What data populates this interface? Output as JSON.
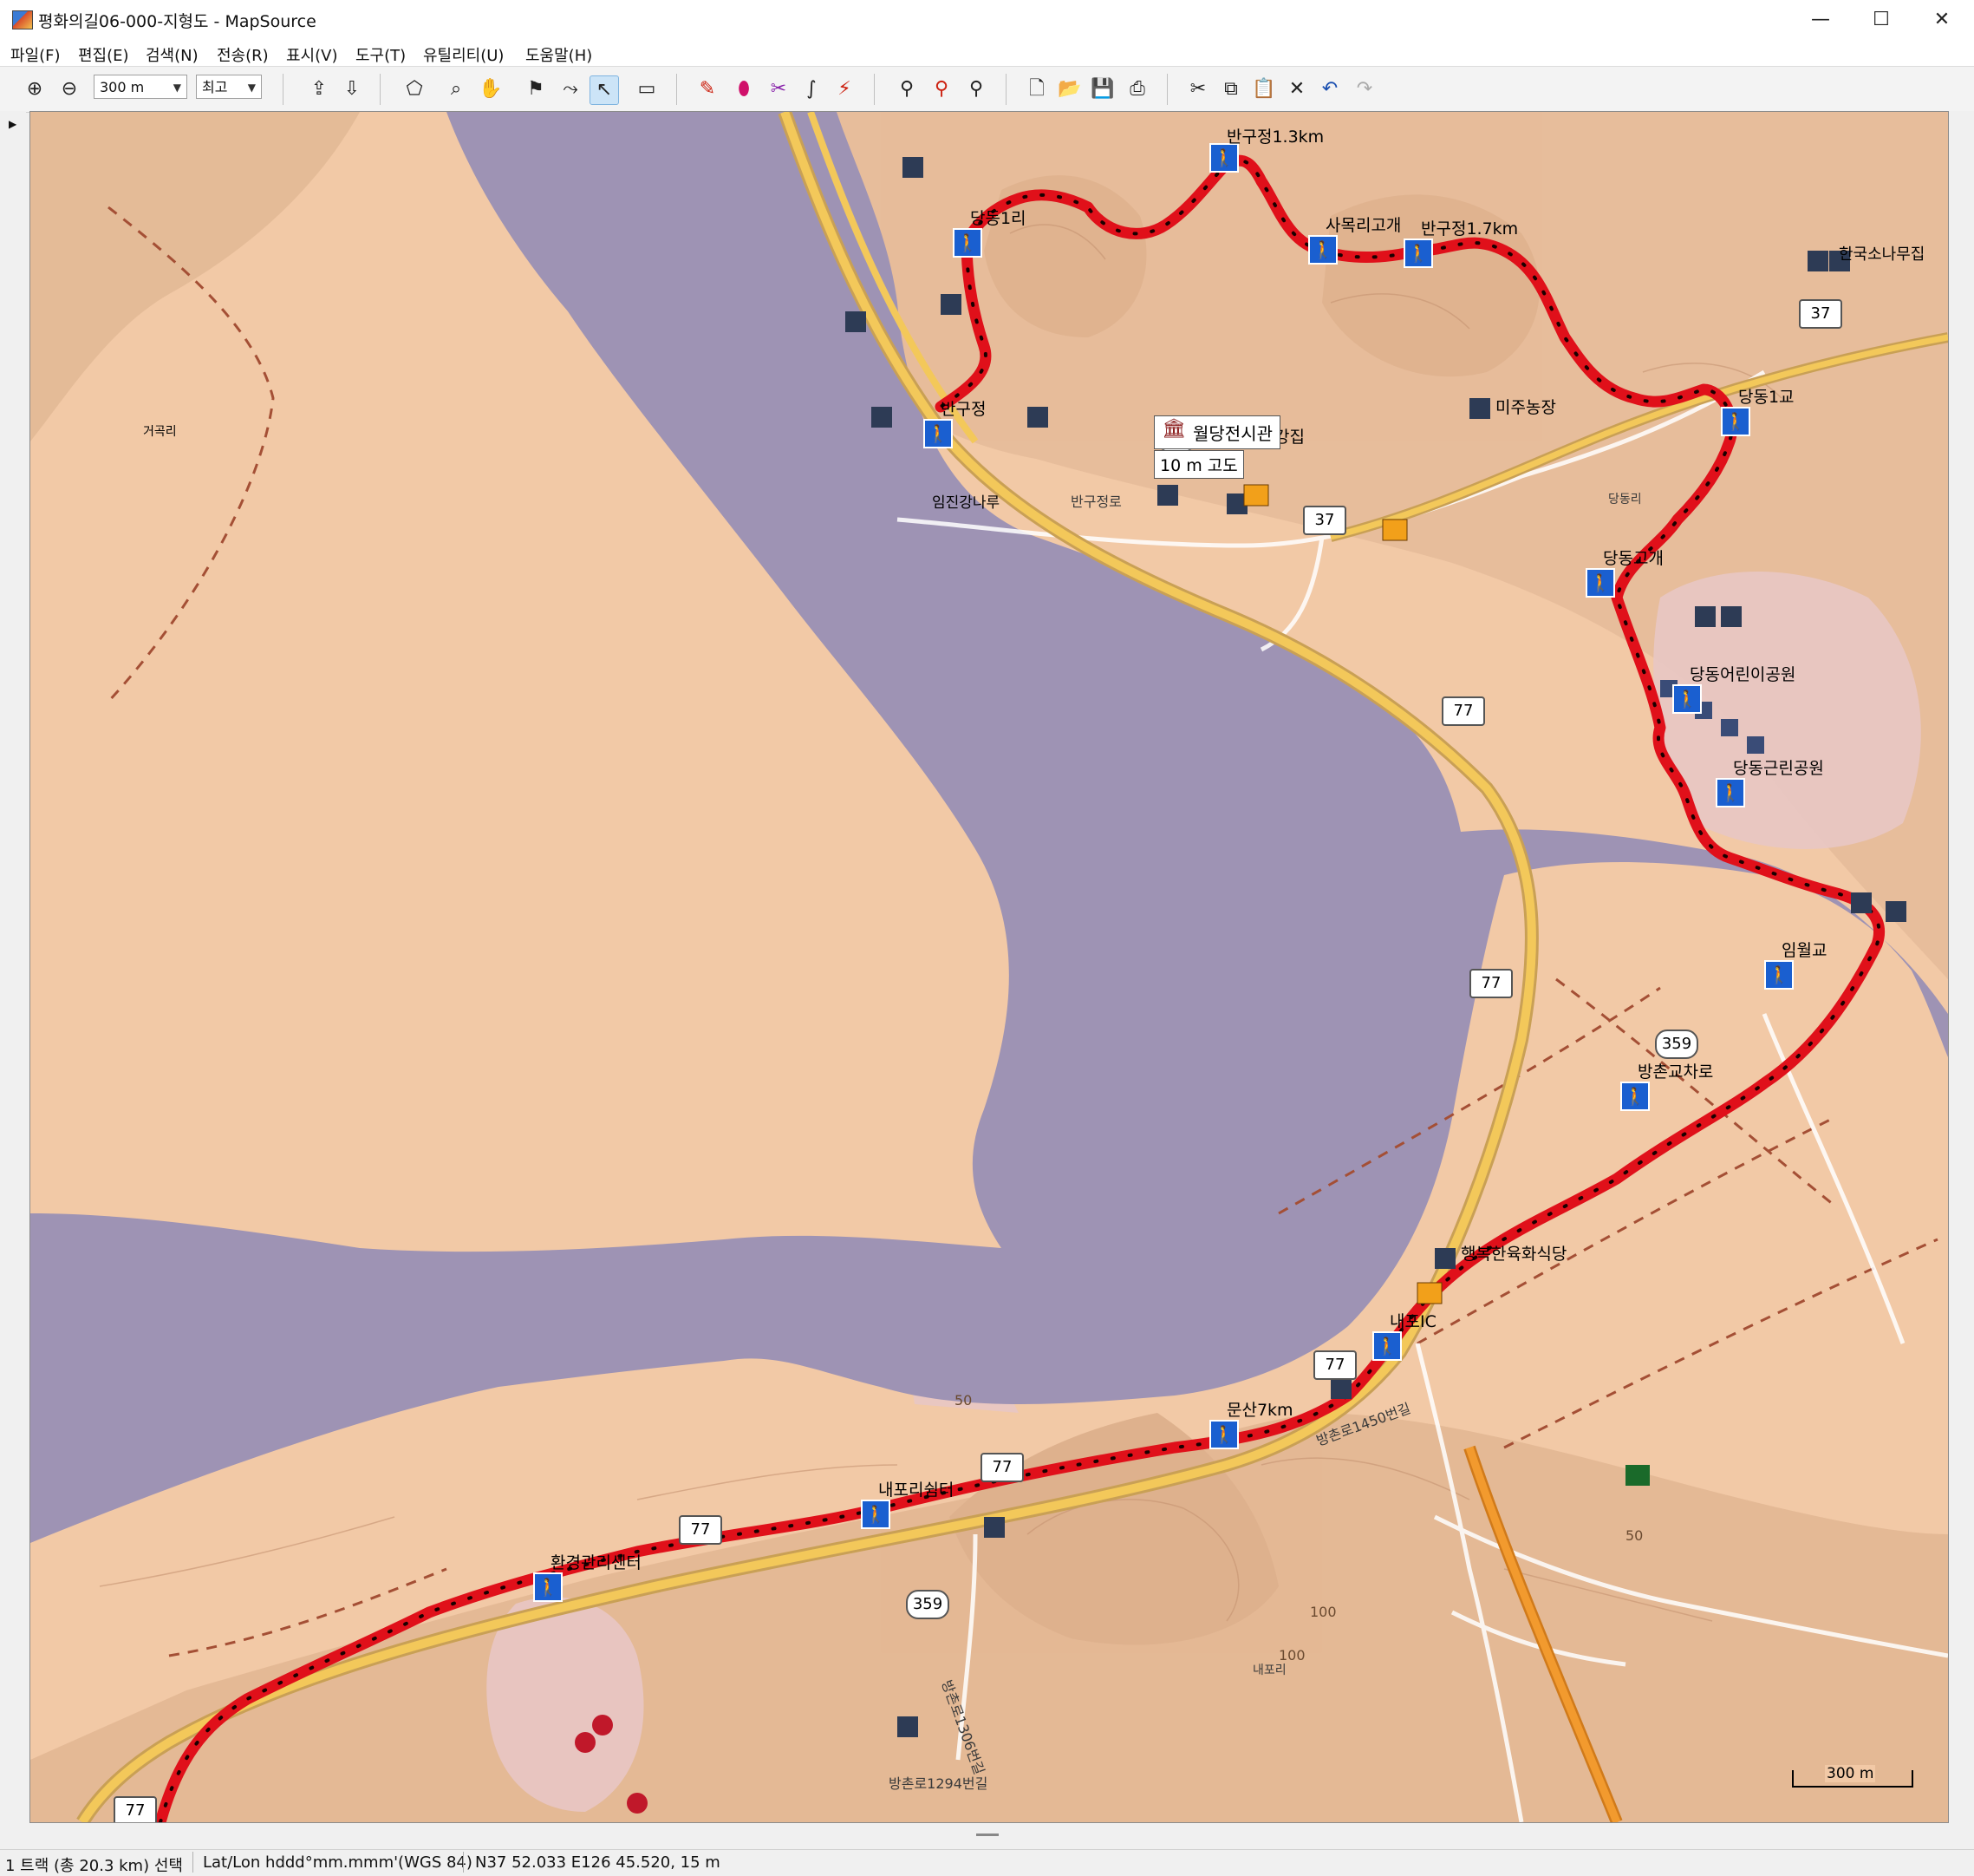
{
  "window": {
    "title": "평화의길06-000-지형도 - MapSource",
    "minimize": "—",
    "maximize": "☐",
    "close": "✕"
  },
  "menu": [
    "파일(F)",
    "편집(E)",
    "검색(N)",
    "전송(R)",
    "표시(V)",
    "도구(T)",
    "유틸리티(U)",
    "도움말(H)"
  ],
  "toolbar": {
    "zoom_scale": "300 m",
    "detail_level": "최고"
  },
  "map": {
    "waypoints": [
      {
        "name": "반구정1.3km"
      },
      {
        "name": "당동1리"
      },
      {
        "name": "사목리고개"
      },
      {
        "name": "반구정1.7km"
      },
      {
        "name": "반구정"
      },
      {
        "name": "당동1교"
      },
      {
        "name": "당동고개"
      },
      {
        "name": "당동어린이공원"
      },
      {
        "name": "당동근린공원"
      },
      {
        "name": "임월교"
      },
      {
        "name": "방촌교차로"
      },
      {
        "name": "내포IC"
      },
      {
        "name": "문산7km"
      },
      {
        "name": "내포리쉼터"
      },
      {
        "name": "환경관리센터"
      }
    ],
    "poi_labels": [
      "미주농장",
      "임진강집",
      "행복한육화식당",
      "한국소나무집",
      "임진강나루",
      "거곡리",
      "반구정로",
      "당동리",
      "내포리",
      "방촌로1450번길",
      "방촌로1306번길",
      "방촌로1294번길"
    ],
    "tooltip": {
      "name": "월당전시관",
      "elevation": "10 m 고도"
    },
    "road_shields": [
      "37",
      "37",
      "77",
      "77",
      "77",
      "77",
      "77",
      "77",
      "359",
      "359"
    ],
    "contour_labels": [
      "50",
      "100",
      "100",
      "50"
    ],
    "scale_bar": "300 m",
    "colors": {
      "land": "#f2c9a6",
      "water": "#9e93b4",
      "track": "#e0101a",
      "road": "#f3c85a"
    }
  },
  "status": {
    "selection": "1 트랙 (총 20.3 km) 선택",
    "coord_format": "Lat/Lon hddd°mm.mmm'(WGS 84)",
    "cursor": "N37 52.033 E126 45.520, 15 m"
  }
}
